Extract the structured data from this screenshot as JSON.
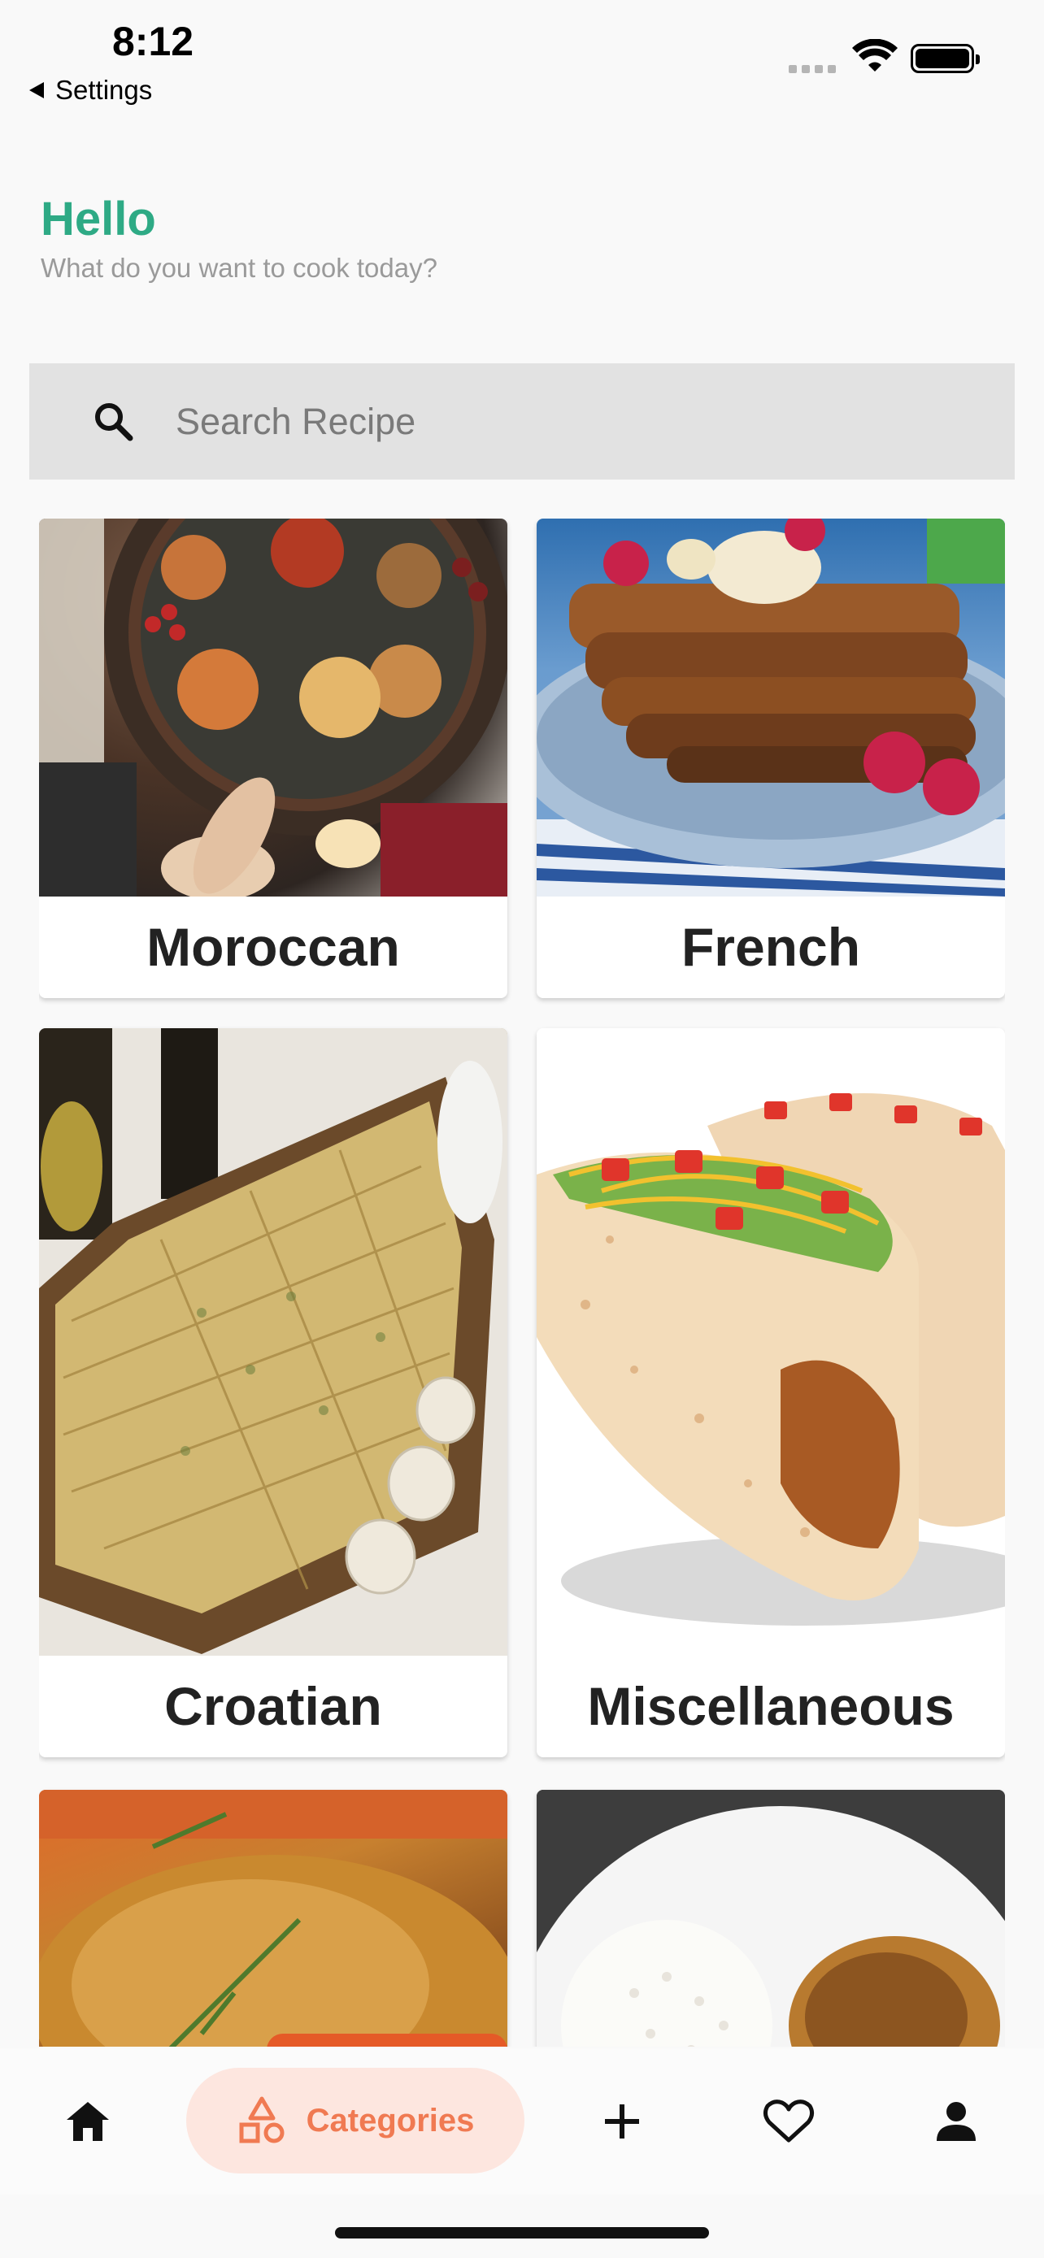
{
  "status_bar": {
    "time": "8:12",
    "back_label": "Settings"
  },
  "greeting": {
    "title": "Hello",
    "subtitle": "What do you want to cook today?"
  },
  "search": {
    "placeholder": "Search Recipe"
  },
  "categories": [
    {
      "label": "Moroccan"
    },
    {
      "label": "French"
    },
    {
      "label": "Croatian"
    },
    {
      "label": "Miscellaneous"
    },
    {
      "label": ""
    },
    {
      "label": ""
    }
  ],
  "bottom_nav": {
    "items": [
      {
        "icon": "home-icon"
      },
      {
        "icon": "categories-icon",
        "label": "Categories",
        "active": true
      },
      {
        "icon": "add-icon"
      },
      {
        "icon": "heart-icon"
      },
      {
        "icon": "profile-icon"
      }
    ]
  },
  "colors": {
    "accent_green": "#2eaa85",
    "accent_orange": "#f07a52",
    "active_pill_bg": "#fde6df"
  }
}
